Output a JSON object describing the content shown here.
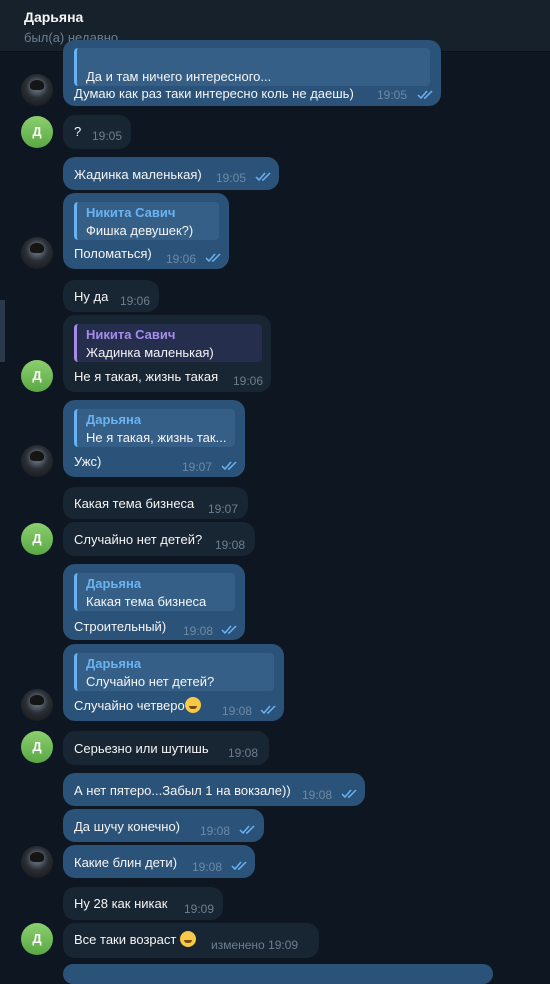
{
  "header": {
    "name": "Дарьяна",
    "status": "был(а) недавно"
  },
  "messages": [
    {
      "quote_text": "Да и там ничего интересного...",
      "text": "Думаю как раз таки интересно коль не даешь)",
      "time": "19:05"
    },
    {
      "text": "?",
      "time": "19:05"
    },
    {
      "text": "Жадинка маленькая)",
      "time": "19:05"
    },
    {
      "quote_name": "Никита Савич",
      "quote_text": "Фишка девушек?)",
      "text": "Поломаться)",
      "time": "19:06"
    },
    {
      "text": "Ну да",
      "time": "19:06"
    },
    {
      "quote_name": "Никита Савич",
      "quote_text": "Жадинка маленькая)",
      "text": "Не я такая, жизнь такая",
      "time": "19:06"
    },
    {
      "quote_name": "Дарьяна",
      "quote_text": "Не я такая, жизнь так...",
      "text": "Ужс)",
      "time": "19:07"
    },
    {
      "text": "Какая тема бизнеса",
      "time": "19:07"
    },
    {
      "text": "Случайно нет детей?",
      "time": "19:08"
    },
    {
      "quote_name": "Дарьяна",
      "quote_text": "Какая тема бизнеса",
      "text": "Строительный)",
      "time": "19:08"
    },
    {
      "quote_name": "Дарьяна",
      "quote_text": "Случайно нет детей?",
      "text": "Случайно четверо",
      "time": "19:08"
    },
    {
      "text": "Серьезно или шутишь",
      "time": "19:08"
    },
    {
      "text": "А нет пятеро...Забыл 1 на вокзале))",
      "time": "19:08"
    },
    {
      "text": "Да шучу конечно)",
      "time": "19:08"
    },
    {
      "text": "Какие блин дети)",
      "time": "19:08"
    },
    {
      "text": "Ну 28 как никак",
      "time": "19:09"
    },
    {
      "text": "Все таки возраст",
      "time": "изменено 19:09"
    }
  ],
  "avatars": {
    "letter": "Д"
  },
  "colors": {
    "outgoing": "#2b5278",
    "incoming": "#182533",
    "background": "#0e1621",
    "accent": "#6ab3f3"
  }
}
